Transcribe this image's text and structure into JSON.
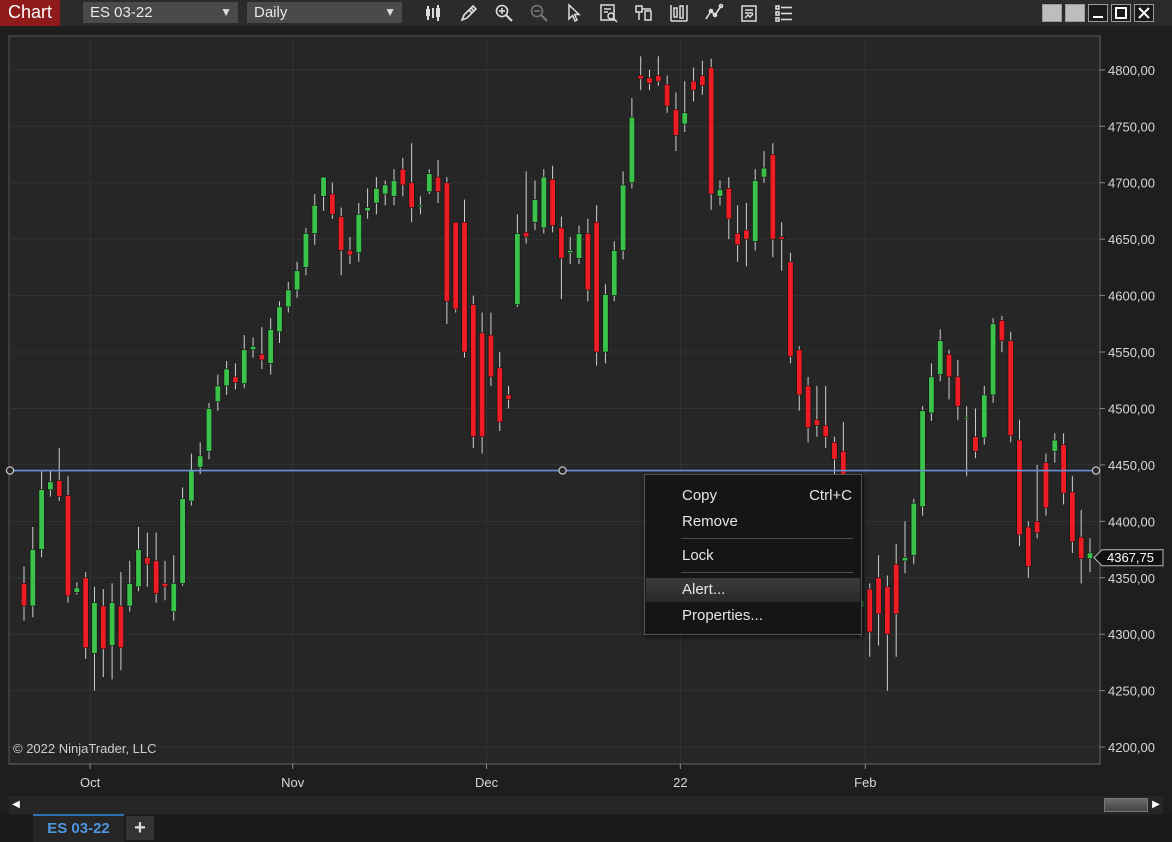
{
  "app": {
    "title": "Chart"
  },
  "toolbar": {
    "instrument": "ES 03-22",
    "period": "Daily",
    "tools": [
      {
        "name": "bar-type-icon"
      },
      {
        "name": "drawing-tools-icon"
      },
      {
        "name": "zoom-in-icon"
      },
      {
        "name": "zoom-out-icon"
      },
      {
        "name": "pointer-icon"
      },
      {
        "name": "data-box-icon"
      },
      {
        "name": "indicators-icon"
      },
      {
        "name": "strategies-icon"
      },
      {
        "name": "chart-trader-icon"
      },
      {
        "name": "templates-icon"
      },
      {
        "name": "properties-icon"
      }
    ]
  },
  "chart": {
    "copyright": "© 2022 NinjaTrader, LLC",
    "price_label": "4367,75",
    "y_ticks": [
      "4800,00",
      "4750,00",
      "4700,00",
      "4650,00",
      "4600,00",
      "4550,00",
      "4500,00",
      "4450,00",
      "4400,00",
      "4350,00",
      "4300,00",
      "4250,00",
      "4200,00"
    ],
    "x_ticks": [
      "Oct",
      "Nov",
      "Dec",
      "22",
      "Feb"
    ]
  },
  "context_menu": {
    "copy": "Copy",
    "copy_shortcut": "Ctrl+C",
    "remove": "Remove",
    "lock": "Lock",
    "alert": "Alert...",
    "properties": "Properties..."
  },
  "tabs": {
    "active": "ES 03-22",
    "add": "+"
  },
  "colors": {
    "up": "#3bc24a",
    "down": "#ee1c24",
    "line": "#6b8fd8",
    "accent": "#2d6fb0"
  },
  "chart_data": {
    "type": "candlestick",
    "title": "",
    "ylim": [
      4185,
      4830
    ],
    "x_ticks": [
      "Oct",
      "Nov",
      "Dec",
      "22",
      "Feb"
    ],
    "horizontal_line": 4445,
    "last_price": 4367.75,
    "candles": [
      [
        4345,
        4325,
        4360,
        4312
      ],
      [
        4325,
        4375,
        4395,
        4315
      ],
      [
        4375,
        4428,
        4445,
        4368
      ],
      [
        4428,
        4435,
        4445,
        4422
      ],
      [
        4436,
        4422,
        4465,
        4418
      ],
      [
        4423,
        4334,
        4440,
        4328
      ],
      [
        4337,
        4341,
        4346,
        4335
      ],
      [
        4350,
        4288,
        4355,
        4278
      ],
      [
        4283,
        4328,
        4342,
        4250
      ],
      [
        4325,
        4287,
        4340,
        4262
      ],
      [
        4290,
        4328,
        4345,
        4260
      ],
      [
        4325,
        4288,
        4355,
        4268
      ],
      [
        4325,
        4345,
        4365,
        4320
      ],
      [
        4342,
        4375,
        4395,
        4338
      ],
      [
        4368,
        4362,
        4390,
        4342
      ],
      [
        4365,
        4336,
        4390,
        4328
      ],
      [
        4345,
        4342,
        4365,
        4330
      ],
      [
        4320,
        4345,
        4370,
        4312
      ],
      [
        4345,
        4420,
        4430,
        4343
      ],
      [
        4418,
        4445,
        4460,
        4414
      ],
      [
        4448,
        4458,
        4470,
        4442
      ],
      [
        4462,
        4500,
        4505,
        4455
      ],
      [
        4506,
        4520,
        4530,
        4498
      ],
      [
        4520,
        4535,
        4542,
        4512
      ],
      [
        4528,
        4523,
        4540,
        4517
      ],
      [
        4522,
        4552,
        4565,
        4518
      ],
      [
        4552,
        4555,
        4563,
        4545
      ],
      [
        4548,
        4543,
        4572,
        4535
      ],
      [
        4540,
        4570,
        4580,
        4530
      ],
      [
        4568,
        4590,
        4595,
        4558
      ],
      [
        4590,
        4605,
        4612,
        4585
      ],
      [
        4605,
        4622,
        4630,
        4598
      ],
      [
        4625,
        4655,
        4660,
        4618
      ],
      [
        4655,
        4680,
        4690,
        4645
      ],
      [
        4688,
        4705,
        4705,
        4675
      ],
      [
        4690,
        4672,
        4700,
        4668
      ],
      [
        4670,
        4640,
        4678,
        4618
      ],
      [
        4640,
        4636,
        4652,
        4628
      ],
      [
        4638,
        4672,
        4682,
        4630
      ],
      [
        4675,
        4678,
        4695,
        4668
      ],
      [
        4682,
        4695,
        4705,
        4672
      ],
      [
        4690,
        4698,
        4702,
        4680
      ],
      [
        4688,
        4702,
        4712,
        4680
      ],
      [
        4712,
        4698,
        4722,
        4688
      ],
      [
        4700,
        4678,
        4735,
        4665
      ],
      [
        4680,
        4680,
        4688,
        4672
      ],
      [
        4692,
        4708,
        4712,
        4690
      ],
      [
        4705,
        4692,
        4720,
        4682
      ],
      [
        4700,
        4595,
        4705,
        4575
      ],
      [
        4665,
        4588,
        4665,
        4585
      ],
      [
        4665,
        4550,
        4685,
        4545
      ],
      [
        4592,
        4475,
        4600,
        4465
      ],
      [
        4567,
        4475,
        4585,
        4460
      ],
      [
        4565,
        4528,
        4585,
        4520
      ],
      [
        4536,
        4488,
        4550,
        4480
      ],
      [
        4512,
        4508,
        4520,
        4500
      ],
      [
        4592,
        4655,
        4672,
        4590
      ],
      [
        4656,
        4652,
        4710,
        4646
      ],
      [
        4665,
        4685,
        4702,
        4658
      ],
      [
        4660,
        4705,
        4712,
        4655
      ],
      [
        4703,
        4662,
        4715,
        4656
      ],
      [
        4660,
        4633,
        4670,
        4597
      ],
      [
        4638,
        4640,
        4652,
        4628
      ],
      [
        4633,
        4655,
        4662,
        4628
      ],
      [
        4655,
        4605,
        4668,
        4595
      ],
      [
        4665,
        4550,
        4680,
        4538
      ],
      [
        4550,
        4601,
        4610,
        4540
      ],
      [
        4600,
        4640,
        4648,
        4595
      ],
      [
        4640,
        4698,
        4710,
        4632
      ],
      [
        4700,
        4758,
        4775,
        4695
      ],
      [
        4795,
        4792,
        4812,
        4782
      ],
      [
        4793,
        4788,
        4800,
        4782
      ],
      [
        4795,
        4790,
        4812,
        4786
      ],
      [
        4787,
        4768,
        4795,
        4762
      ],
      [
        4765,
        4742,
        4780,
        4728
      ],
      [
        4752,
        4762,
        4790,
        4745
      ],
      [
        4790,
        4782,
        4802,
        4772
      ],
      [
        4795,
        4786,
        4808,
        4778
      ],
      [
        4802,
        4690,
        4810,
        4676
      ],
      [
        4688,
        4694,
        4702,
        4680
      ],
      [
        4695,
        4668,
        4705,
        4650
      ],
      [
        4655,
        4645,
        4680,
        4630
      ],
      [
        4658,
        4650,
        4682,
        4626
      ],
      [
        4648,
        4702,
        4712,
        4640
      ],
      [
        4705,
        4713,
        4728,
        4700
      ],
      [
        4725,
        4650,
        4735,
        4634
      ],
      [
        4652,
        4650,
        4665,
        4622
      ],
      [
        4630,
        4546,
        4638,
        4540
      ],
      [
        4552,
        4512,
        4555,
        4498
      ],
      [
        4520,
        4483,
        4528,
        4470
      ],
      [
        4490,
        4485,
        4520,
        4475
      ],
      [
        4485,
        4475,
        4520,
        4465
      ],
      [
        4470,
        4455,
        4475,
        4438
      ],
      [
        4462,
        4365,
        4488,
        4355
      ],
      [
        4368,
        4325,
        4382,
        4310
      ],
      [
        4324,
        4330,
        4345,
        4298
      ],
      [
        4340,
        4302,
        4345,
        4280
      ],
      [
        4350,
        4318,
        4370,
        4290
      ],
      [
        4342,
        4300,
        4352,
        4250
      ],
      [
        4362,
        4318,
        4380,
        4280
      ],
      [
        4365,
        4368,
        4400,
        4354
      ],
      [
        4370,
        4416,
        4420,
        4362
      ],
      [
        4413,
        4498,
        4502,
        4405
      ],
      [
        4496,
        4528,
        4540,
        4489
      ],
      [
        4530,
        4560,
        4570,
        4524
      ],
      [
        4548,
        4528,
        4552,
        4508
      ],
      [
        4528,
        4502,
        4543,
        4490
      ],
      [
        4492,
        4492,
        4502,
        4440
      ],
      [
        4475,
        4462,
        4500,
        4456
      ],
      [
        4474,
        4512,
        4520,
        4468
      ],
      [
        4512,
        4575,
        4580,
        4505
      ],
      [
        4578,
        4560,
        4582,
        4550
      ],
      [
        4560,
        4476,
        4568,
        4470
      ],
      [
        4472,
        4388,
        4490,
        4378
      ],
      [
        4395,
        4360,
        4400,
        4350
      ],
      [
        4400,
        4390,
        4450,
        4385
      ],
      [
        4452,
        4412,
        4460,
        4405
      ],
      [
        4462,
        4472,
        4478,
        4452
      ],
      [
        4468,
        4425,
        4478,
        4415
      ],
      [
        4426,
        4382,
        4440,
        4372
      ],
      [
        4386,
        4367,
        4410,
        4345
      ],
      [
        4367,
        4372,
        4385,
        4355
      ]
    ]
  }
}
